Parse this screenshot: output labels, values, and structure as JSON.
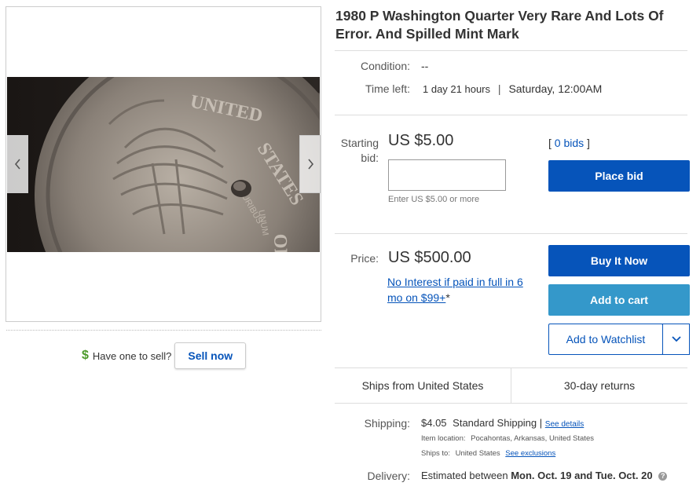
{
  "item": {
    "title": "1980 P Washington Quarter Very Rare And Lots Of Error. And Spilled Mint Mark",
    "condition_label": "Condition:",
    "condition_value": "--",
    "time_left_label": "Time left:",
    "time_left_value": "1 day 21 hours",
    "time_left_sep": "|",
    "end_time": "Saturday, 12:00AM"
  },
  "gallery": {
    "prev_icon": "chevron-left-icon",
    "next_icon": "chevron-right-icon"
  },
  "sell": {
    "icon": "dollar-icon",
    "icon_glyph": "$",
    "question": "Have one to sell?",
    "button": "Sell now"
  },
  "bid": {
    "label": "Starting bid:",
    "price": "US $5.00",
    "bids_open": "[",
    "bids_count": "0 bids",
    "bids_close": "]",
    "input_value": "",
    "hint": "Enter US $5.00 or more",
    "place_button": "Place bid"
  },
  "buy": {
    "label": "Price:",
    "price": "US $500.00",
    "financing": "No Interest if paid in full in 6 mo on $99+",
    "financing_asterisk": "*",
    "buy_button": "Buy It Now",
    "cart_button": "Add to cart",
    "watch_button": "Add to Watchlist",
    "watch_dropdown_icon": "chevron-down-icon"
  },
  "summary": {
    "ships_from": "Ships from United States",
    "returns": "30-day returns"
  },
  "shipping": {
    "label": "Shipping:",
    "cost": "$4.05",
    "service": "Standard Shipping",
    "sep": "|",
    "details_link": "See details",
    "location_label": "Item location:",
    "location_value": "Pocahontas, Arkansas, United States",
    "ships_to_label": "Ships to:",
    "ships_to_value": "United States",
    "exclusions_link": "See exclusions"
  },
  "delivery": {
    "label": "Delivery:",
    "prefix": "Estimated between",
    "dates": "Mon. Oct. 19 and Tue. Oct. 20",
    "help_icon": "question-icon",
    "help_glyph": "?"
  },
  "colors": {
    "primary_blue": "#0654ba",
    "light_blue": "#3498ca",
    "dollar_green": "#4c9a2a"
  }
}
